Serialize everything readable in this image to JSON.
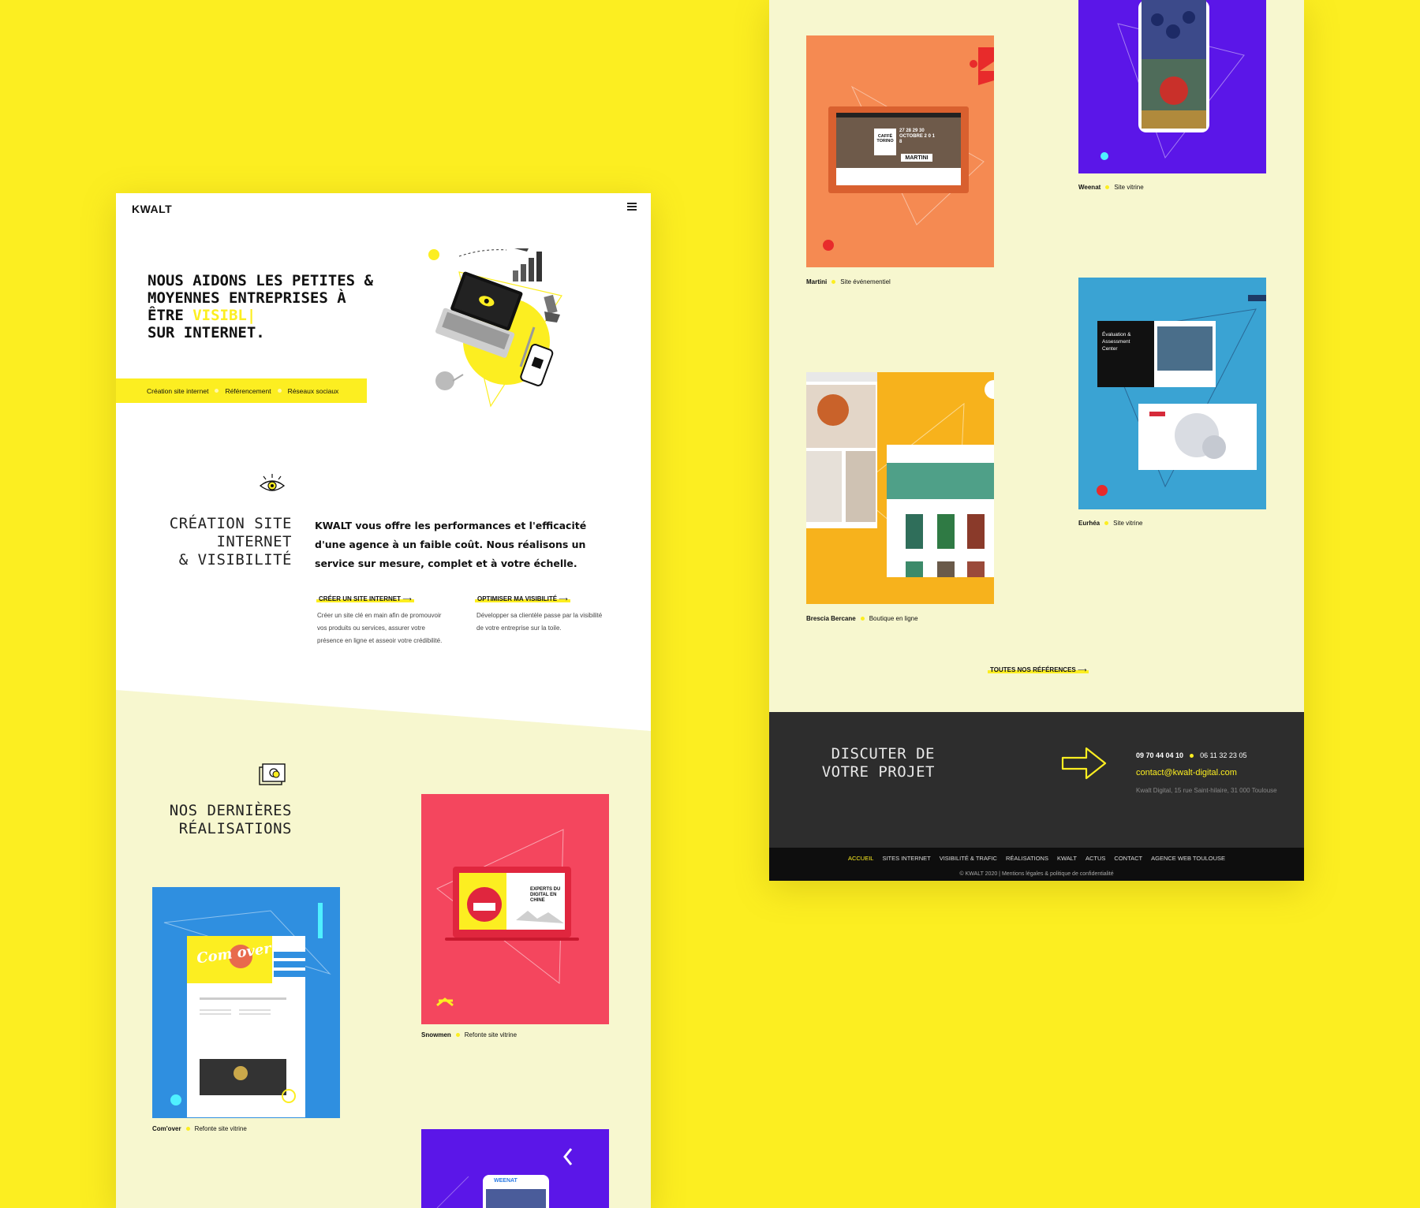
{
  "header": {
    "logo": "KWALT"
  },
  "hero": {
    "title_before": "NOUS AIDONS LES PETITES &\nMOYENNES ENTREPRISES À\nÊTRE ",
    "title_highlight": "VISIBL|",
    "title_after": "\nSUR INTERNET.",
    "tags": [
      "Création site internet",
      "Référencement",
      "Réseaux sociaux"
    ]
  },
  "services": {
    "title": "CRÉATION SITE\nINTERNET\n& VISIBILITÉ",
    "intro": "KWALT vous offre les performances et l'efficacité d'une agence à un faible coût. Nous réalisons un service sur mesure, complet et à votre échelle.",
    "create_link": "CRÉER UN SITE INTERNET",
    "create_desc": "Créer un site clé en main afin de promouvoir vos produits ou services, assurer votre présence en ligne et asseoir votre crédibilité.",
    "optimize_link": "OPTIMISER MA VISIBILITÉ",
    "optimize_desc": "Développer sa clientèle passe par la visibilité de votre entreprise sur la toile.",
    "arrow": "⟶"
  },
  "realisations": {
    "title": "NOS DERNIÈRES\nRÉALISATIONS",
    "items": [
      {
        "name": "Snowmen",
        "type": "Refonte site vitrine",
        "mock_text": "EXPERTS DU DIGITAL EN CHINE"
      },
      {
        "name": "Com'over",
        "type": "Refonte site vitrine",
        "mock_text": "Com over"
      },
      {
        "name": "WEENAT",
        "type": ""
      },
      {
        "name": "Martini",
        "type": "Site événementiel",
        "mock_text": "CAFFÈ TORINO",
        "mock_date": "27 28 29 30 OCTOBRE 2 0 1 8",
        "mock_brand": "MARTINI"
      },
      {
        "name": "Weenat",
        "type": "Site vitrine"
      },
      {
        "name": "Eurhéa",
        "type": "Site vitrine",
        "mock_text": "Évaluation & Assessment Center"
      },
      {
        "name": "Brescia Bercane",
        "type": "Boutique en ligne"
      }
    ],
    "all_link": "TOUTES NOS RÉFÉRENCES"
  },
  "footer": {
    "title": "DISCUTER DE\nVOTRE PROJET",
    "phone1": "09 70 44 04 10",
    "phone2": "06 11 32 23 05",
    "email": "contact@kwalt-digital.com",
    "address": "Kwalt Digital, 15 rue Saint-hilaire, 31 000 Toulouse",
    "nav": [
      "ACCUEIL",
      "SITES INTERNET",
      "VISIBILITÉ & TRAFIC",
      "RÉALISATIONS",
      "KWALT",
      "ACTUS",
      "CONTACT",
      "AGENCE WEB TOULOUSE"
    ],
    "copyright": "© KWALT 2020 | Mentions légales & politique de confidentialité"
  },
  "colors": {
    "brand_yellow": "#fcee21",
    "cream": "#f7f7cf",
    "snowmen_bg": "#f4465e",
    "comover_bg": "#2f8fe0",
    "weenat_bg": "#5b16e8",
    "martini_bg": "#f58a52",
    "eurhea_bg": "#3aa3d3",
    "brescia_bg": "#f7b21c",
    "footer_dark": "#2d2d2d"
  }
}
